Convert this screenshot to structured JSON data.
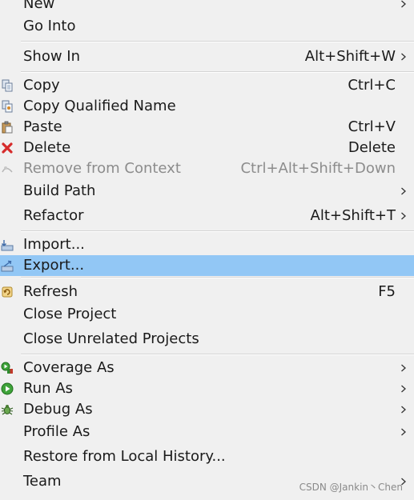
{
  "menu": {
    "items": [
      {
        "label": "New",
        "shortcut": "",
        "submenu": true
      },
      {
        "label": "Go Into",
        "shortcut": ""
      },
      {
        "label": "Show In",
        "shortcut": "Alt+Shift+W",
        "submenu": true
      },
      {
        "label": "Copy",
        "shortcut": "Ctrl+C",
        "icon": "copy-icon"
      },
      {
        "label": "Copy Qualified Name",
        "shortcut": "",
        "icon": "copy-qualified-name-icon"
      },
      {
        "label": "Paste",
        "shortcut": "Ctrl+V",
        "icon": "paste-icon"
      },
      {
        "label": "Delete",
        "shortcut": "Delete",
        "icon": "delete-icon"
      },
      {
        "label": "Remove from Context",
        "shortcut": "Ctrl+Alt+Shift+Down",
        "icon": "remove-from-context-icon",
        "disabled": true
      },
      {
        "label": "Build Path",
        "shortcut": "",
        "submenu": true
      },
      {
        "label": "Refactor",
        "shortcut": "Alt+Shift+T",
        "submenu": true
      },
      {
        "label": "Import...",
        "shortcut": "",
        "icon": "import-icon"
      },
      {
        "label": "Export...",
        "shortcut": "",
        "icon": "export-icon",
        "highlighted": true
      },
      {
        "label": "Refresh",
        "shortcut": "F5",
        "icon": "refresh-icon"
      },
      {
        "label": "Close Project",
        "shortcut": ""
      },
      {
        "label": "Close Unrelated Projects",
        "shortcut": ""
      },
      {
        "label": "Coverage As",
        "shortcut": "",
        "icon": "coverage-icon",
        "submenu": true
      },
      {
        "label": "Run As",
        "shortcut": "",
        "icon": "run-icon",
        "submenu": true
      },
      {
        "label": "Debug As",
        "shortcut": "",
        "icon": "debug-icon",
        "submenu": true
      },
      {
        "label": "Profile As",
        "shortcut": "",
        "submenu": true
      },
      {
        "label": "Restore from Local History...",
        "shortcut": ""
      },
      {
        "label": "Team",
        "shortcut": "",
        "submenu": true
      }
    ]
  },
  "watermark": "CSDN @Jankin丶Chen",
  "colors": {
    "background": "#f0f0f0",
    "highlight": "#92c7f5",
    "text": "#1a1a1a",
    "disabled_text": "#8c8c8c",
    "separator": "#d4d4d4"
  }
}
